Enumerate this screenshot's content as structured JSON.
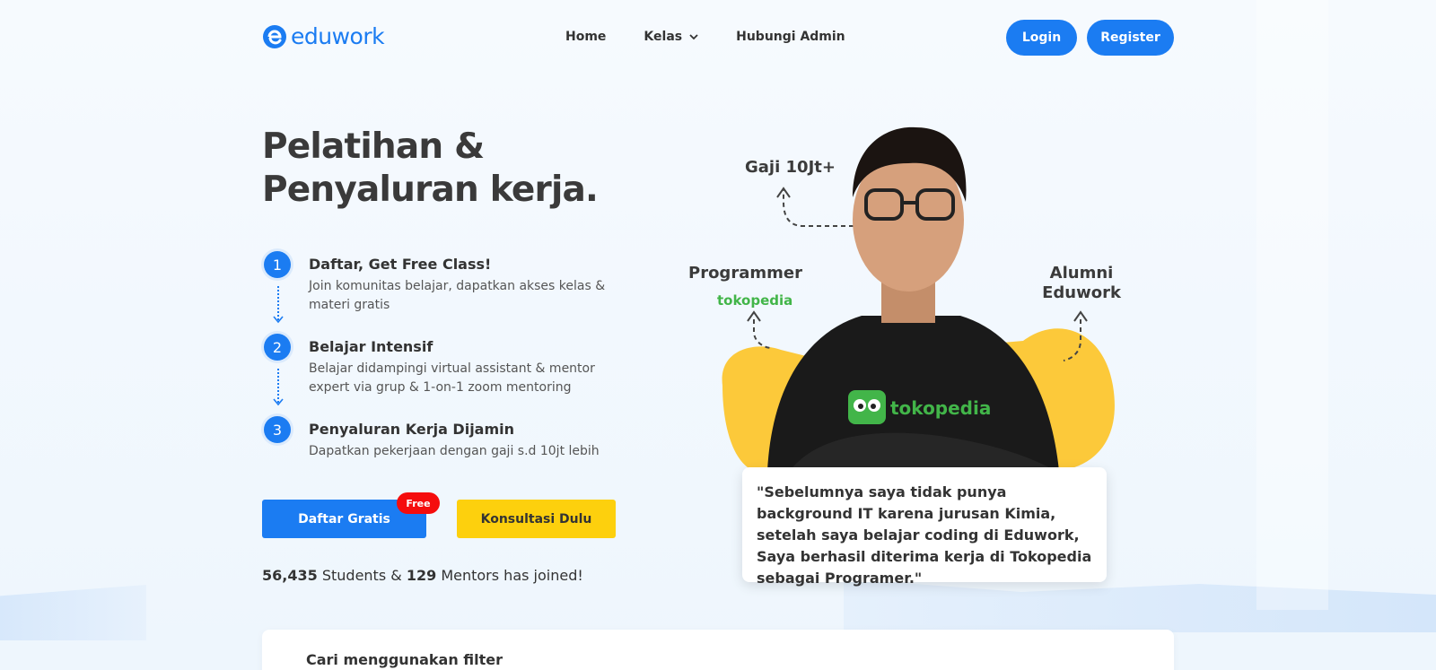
{
  "brand": {
    "name": "eduwork",
    "color": "#1b7cf2"
  },
  "nav": {
    "home": "Home",
    "kelas": "Kelas",
    "hubungi": "Hubungi Admin",
    "login": "Login",
    "register": "Register"
  },
  "hero": {
    "title_line1": "Pelatihan &",
    "title_line2": "Penyaluran kerja.",
    "steps": [
      {
        "num": "1",
        "title": "Daftar, Get Free Class!",
        "desc": "Join komunitas belajar, dapatkan akses kelas & materi gratis"
      },
      {
        "num": "2",
        "title": "Belajar Intensif",
        "desc": "Belajar didampingi virtual assistant & mentor expert via grup & 1-on-1 zoom mentoring"
      },
      {
        "num": "3",
        "title": "Penyaluran Kerja Dijamin",
        "desc": "Dapatkan pekerjaan dengan gaji s.d 10jt lebih"
      }
    ],
    "cta_daftar": "Daftar Gratis",
    "badge_free": "Free",
    "cta_konsul": "Konsultasi Dulu",
    "stats": {
      "students": "56,435",
      "students_label": "Students &",
      "mentors": "129",
      "mentors_label": "Mentors has joined!"
    }
  },
  "illustration": {
    "gaji": "Gaji 10Jt+",
    "programmer": "Programmer",
    "tokopedia_small": "tokopedia",
    "alumni": "Alumni Eduwork",
    "shirt_brand": "tokopedia",
    "quote": "\"Sebelumnya saya tidak punya background IT karena jurusan Kimia, setelah saya belajar coding di Eduwork, Saya berhasil diterima kerja di Tokopedia sebagai Programer.\""
  },
  "filter": {
    "title": "Cari menggunakan filter"
  },
  "colors": {
    "primary": "#1b7cf2",
    "accent_yellow": "#fdd00d",
    "badge_red": "#f50d0d",
    "tokopedia_green": "#42b549"
  }
}
